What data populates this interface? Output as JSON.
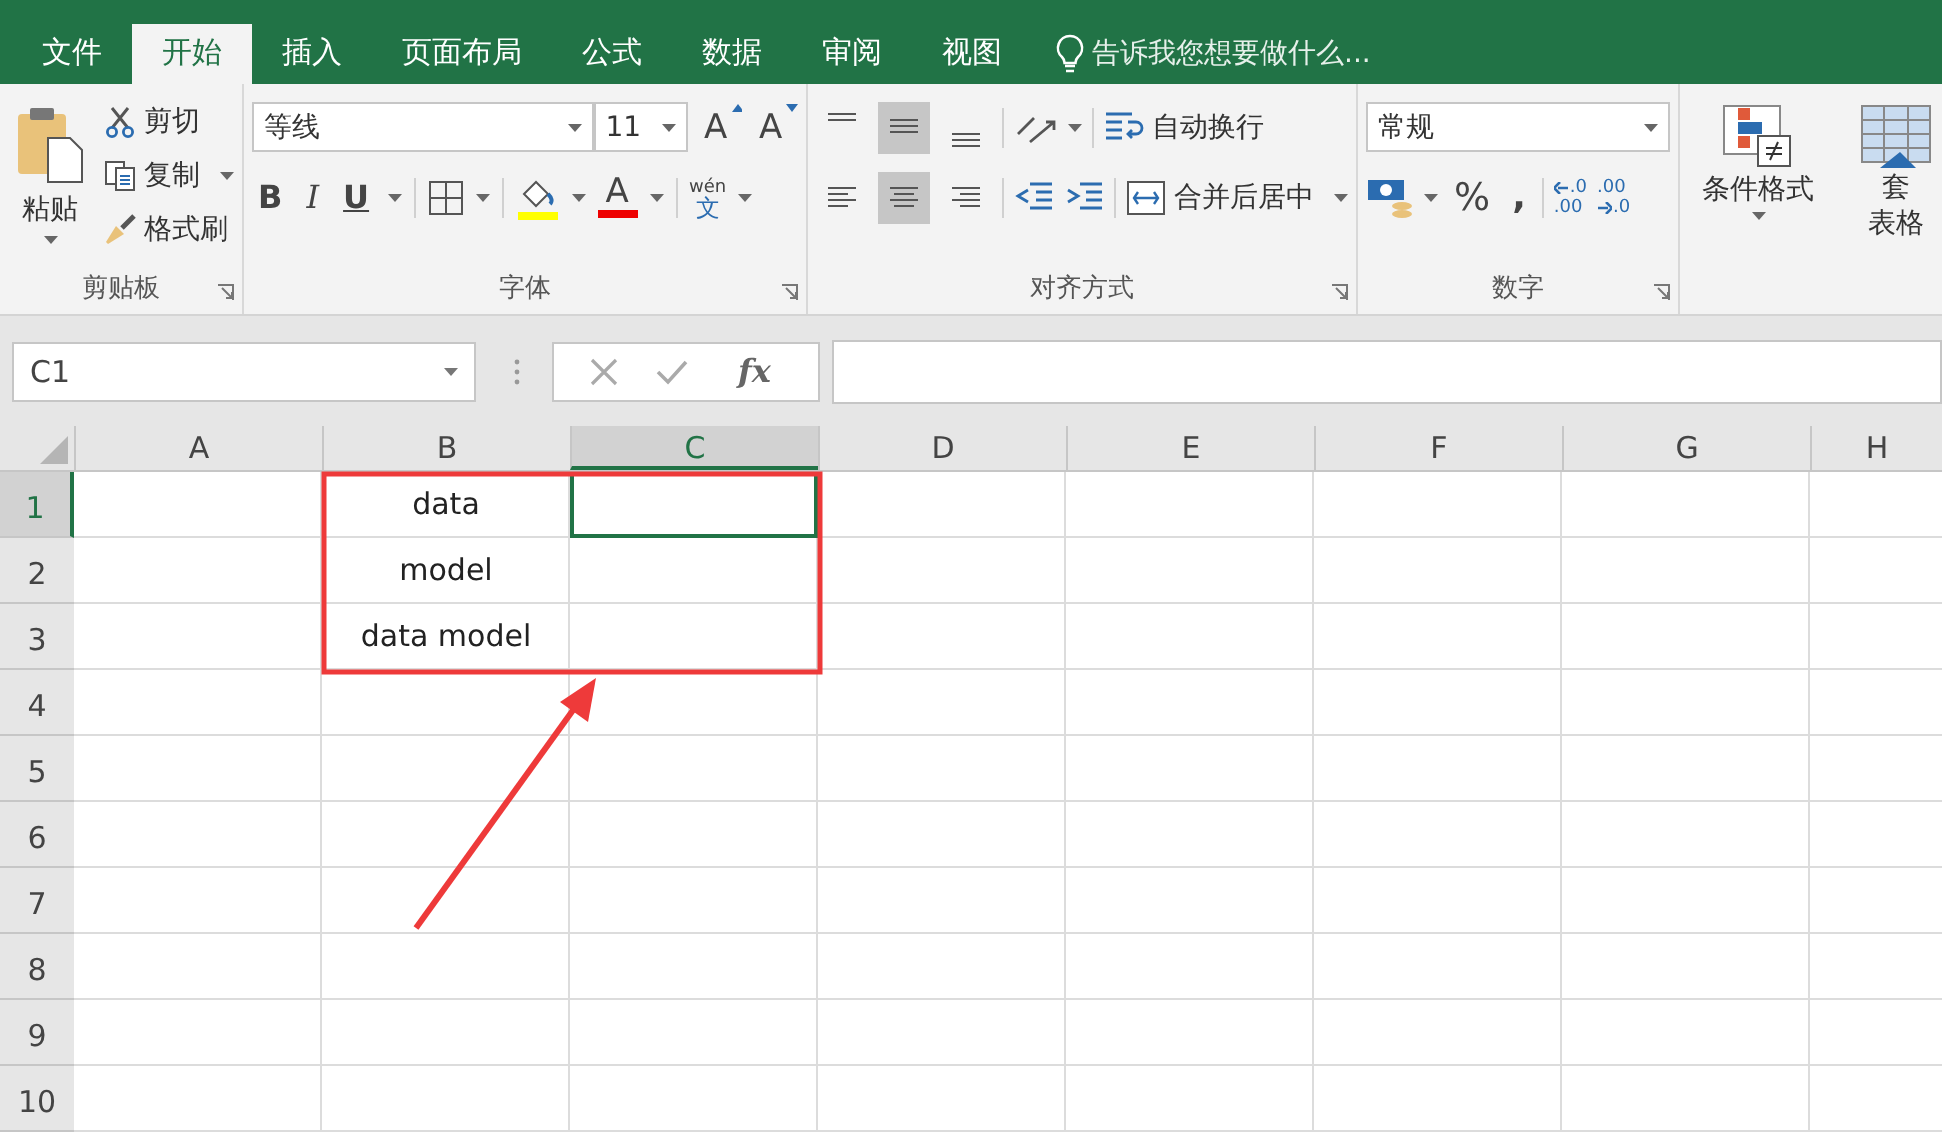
{
  "tabs": [
    {
      "label": "文件",
      "selected": false
    },
    {
      "label": "开始",
      "selected": true
    },
    {
      "label": "插入",
      "selected": false
    },
    {
      "label": "页面布局",
      "selected": false
    },
    {
      "label": "公式",
      "selected": false
    },
    {
      "label": "数据",
      "selected": false
    },
    {
      "label": "审阅",
      "selected": false
    },
    {
      "label": "视图",
      "selected": false
    }
  ],
  "tell_me": {
    "placeholder": "告诉我您想要做什么..."
  },
  "clipboard": {
    "paste": "粘贴",
    "cut": "剪切",
    "copy": "复制",
    "format_painter": "格式刷",
    "label": "剪贴板"
  },
  "font": {
    "name": "等线",
    "size": "11",
    "grow": "A",
    "shrink": "A",
    "bold": "B",
    "italic": "I",
    "underline": "U",
    "color_letter": "A",
    "phonetic_top": "wén",
    "phonetic_bottom": "文",
    "label": "字体"
  },
  "alignment": {
    "vertical": [
      {
        "selected": false
      },
      {
        "selected": true
      },
      {
        "selected": false
      }
    ],
    "horizontal": [
      {
        "selected": false
      },
      {
        "selected": true
      },
      {
        "selected": false
      }
    ],
    "wrap_text": "自动换行",
    "merge_center": "合并后居中",
    "label": "对齐方式"
  },
  "number": {
    "format": "常规",
    "percent": "%",
    "comma": ",",
    "increase_decimal": [
      ".0",
      ".00"
    ],
    "decrease_decimal": [
      ".00",
      ".0"
    ],
    "label": "数字"
  },
  "styles": {
    "conditional_formatting": "条件格式",
    "table_format": [
      "套",
      "表格"
    ]
  },
  "formula_bar": {
    "name_box": "C1",
    "fx": "fx"
  },
  "sheet": {
    "columns": [
      {
        "label": "A",
        "selected": false
      },
      {
        "label": "B",
        "selected": false
      },
      {
        "label": "C",
        "selected": true
      },
      {
        "label": "D",
        "selected": false
      },
      {
        "label": "E",
        "selected": false
      },
      {
        "label": "F",
        "selected": false
      },
      {
        "label": "G",
        "selected": false
      },
      {
        "label": "H",
        "selected": false
      }
    ],
    "rows": [
      {
        "label": "1",
        "selected": true,
        "cells": [
          "",
          "data",
          ""
        ]
      },
      {
        "label": "2",
        "selected": false,
        "cells": [
          "",
          "model",
          ""
        ]
      },
      {
        "label": "3",
        "selected": false,
        "cells": [
          "",
          "data model",
          ""
        ]
      },
      {
        "label": "4",
        "selected": false,
        "cells": []
      },
      {
        "label": "5",
        "selected": false,
        "cells": []
      },
      {
        "label": "6",
        "selected": false,
        "cells": []
      },
      {
        "label": "7",
        "selected": false,
        "cells": []
      },
      {
        "label": "8",
        "selected": false,
        "cells": []
      },
      {
        "label": "9",
        "selected": false,
        "cells": []
      },
      {
        "label": "10",
        "selected": false,
        "cells": []
      }
    ]
  }
}
